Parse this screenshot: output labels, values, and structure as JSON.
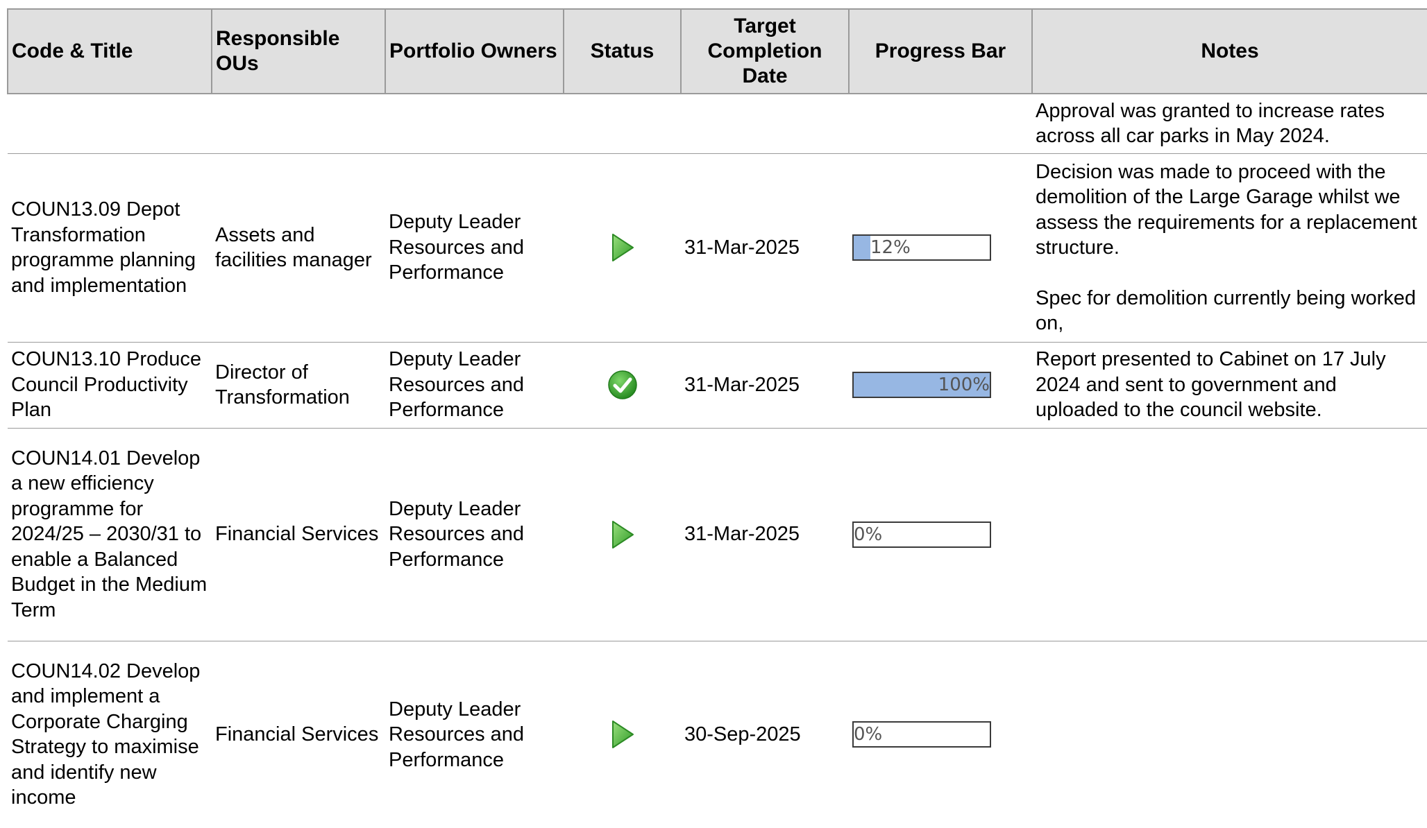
{
  "headers": {
    "code_title": "Code & Title",
    "responsible": "Responsible OUs",
    "owners": "Portfolio Owners",
    "status": "Status",
    "target_date": "Target Completion Date",
    "progress": "Progress Bar",
    "notes": "Notes"
  },
  "rows": [
    {
      "code_title": "",
      "responsible": "",
      "owners": "",
      "status": "",
      "target_date": "",
      "progress": null,
      "progress_label": "",
      "notes": [
        "Approval was granted to increase rates across all car parks in May 2024."
      ]
    },
    {
      "code_title": "COUN13.09 Depot Transformation programme planning and implementation",
      "responsible": "Assets and facilities manager",
      "owners": "Deputy Leader Resources and Performance",
      "status": "in-progress-icon",
      "target_date": "31-Mar-2025",
      "progress": 0.12,
      "progress_label": "12%",
      "notes": [
        "Decision was made to proceed with the demolition of the Large Garage whilst we assess the requirements for a replacement structure.",
        "Spec for demolition currently being worked on,"
      ]
    },
    {
      "code_title": "COUN13.10 Produce Council Productivity Plan",
      "responsible": "Director of Transformation",
      "owners": "Deputy Leader Resources and Performance",
      "status": "completed-icon",
      "target_date": "31-Mar-2025",
      "progress": 1.0,
      "progress_label": "100%",
      "notes": [
        "Report presented to Cabinet on 17 July 2024 and sent to government and uploaded to the council website."
      ]
    },
    {
      "code_title": "COUN14.01 Develop a new efficiency programme for 2024/25 – 2030/31 to enable a Balanced Budget in the Medium Term",
      "responsible": "Financial Services",
      "owners": "Deputy Leader Resources and Performance",
      "status": "in-progress-icon",
      "target_date": "31-Mar-2025",
      "progress": 0,
      "progress_label": "0%",
      "notes": []
    },
    {
      "code_title": "COUN14.02 Develop and implement a Corporate Charging Strategy to maximise and identify new income",
      "responsible": "Financial Services",
      "owners": "Deputy Leader Resources and Performance",
      "status": "in-progress-icon",
      "target_date": "30-Sep-2025",
      "progress": 0,
      "progress_label": "0%",
      "notes": []
    }
  ],
  "colors": {
    "header_bg": "#e0e0e0",
    "progress_fill": "#97b7e3",
    "status_green": "#4cbb3c"
  }
}
